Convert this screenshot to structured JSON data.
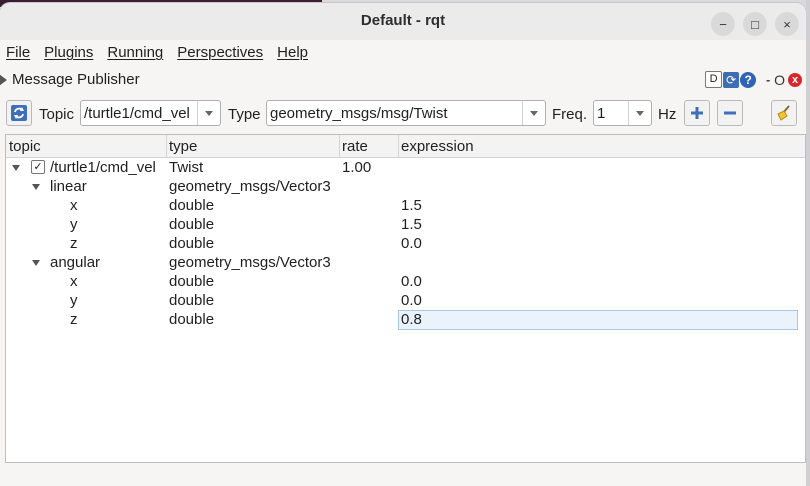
{
  "window": {
    "title": "Default - rqt",
    "buttons": {
      "minimize": "−",
      "maximize": "□",
      "close": "×"
    }
  },
  "menu": [
    "File",
    "Plugins",
    "Running",
    "Perspectives",
    "Help"
  ],
  "plugin": {
    "title": "Message Publisher",
    "dock": {
      "d_label": "D",
      "minimize_label": "-",
      "o_label": "O",
      "close_label": "x"
    }
  },
  "toolbar": {
    "topic_label": "Topic",
    "topic_value": "/turtle1/cmd_vel",
    "type_label": "Type",
    "type_value": "geometry_msgs/msg/Twist",
    "freq_label": "Freq.",
    "freq_value": "1",
    "hz_label": "Hz"
  },
  "columns": [
    "topic",
    "type",
    "rate",
    "expression"
  ],
  "rows": [
    {
      "topic": "/turtle1/cmd_vel",
      "type": "Twist",
      "rate": "1.00",
      "expression": "",
      "checked": true
    },
    {
      "topic": "linear",
      "type": "geometry_msgs/Vector3",
      "rate": "",
      "expression": ""
    },
    {
      "topic": "x",
      "type": "double",
      "rate": "",
      "expression": "1.5"
    },
    {
      "topic": "y",
      "type": "double",
      "rate": "",
      "expression": "1.5"
    },
    {
      "topic": "z",
      "type": "double",
      "rate": "",
      "expression": "0.0"
    },
    {
      "topic": "angular",
      "type": "geometry_msgs/Vector3",
      "rate": "",
      "expression": ""
    },
    {
      "topic": "x",
      "type": "double",
      "rate": "",
      "expression": "0.0"
    },
    {
      "topic": "y",
      "type": "double",
      "rate": "",
      "expression": "0.0"
    },
    {
      "topic": "z",
      "type": "double",
      "rate": "",
      "expression": "0.8",
      "selected": true
    }
  ]
}
